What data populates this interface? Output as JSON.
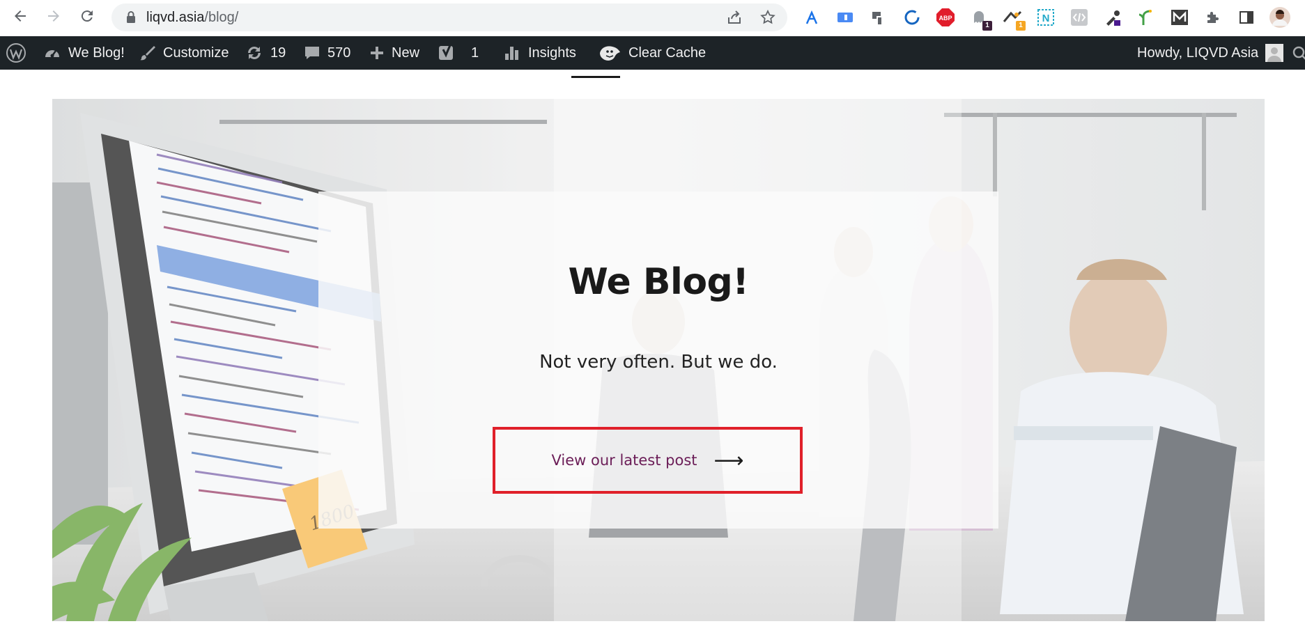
{
  "browser": {
    "url_host": "liqvd.asia",
    "url_path": "/blog/",
    "extension_badges": {
      "ghost": "1",
      "warning": "1"
    }
  },
  "adminbar": {
    "site_name": "We Blog!",
    "customize": "Customize",
    "updates_count": "19",
    "comments_count": "570",
    "new_label": "New",
    "yoast_count": "1",
    "insights_label": "Insights",
    "clear_cache_label": "Clear Cache",
    "howdy": "Howdy, LIQVD Asia"
  },
  "hero": {
    "title": "We Blog!",
    "subtitle": "Not very often. But we do.",
    "cta_label": "View our latest post",
    "cta_arrow": "⟶",
    "note_text": "1800"
  },
  "colors": {
    "adminbar_bg": "#1d2327",
    "cta_border": "#e0202a",
    "cta_text": "#6b1d57"
  }
}
